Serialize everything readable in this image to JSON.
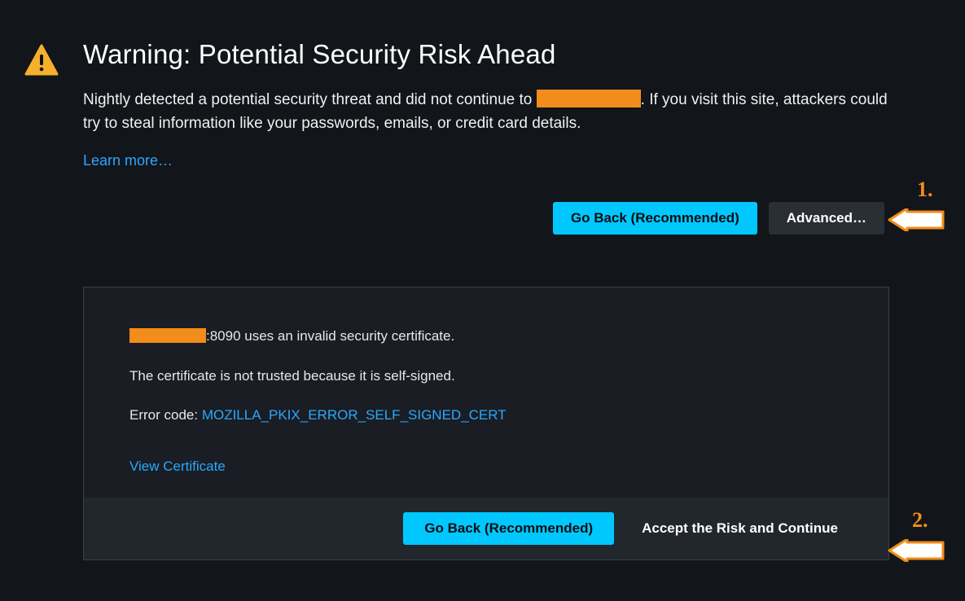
{
  "warning": {
    "title": "Warning: Potential Security Risk Ahead",
    "body_before": "Nightly detected a potential security threat and did not continue to ",
    "body_after": ". If you visit this site, attackers could try to steal information like your passwords, emails, or credit card details.",
    "learn_more": "Learn more…"
  },
  "buttons": {
    "go_back": "Go Back (Recommended)",
    "advanced": "Advanced…",
    "go_back_2": "Go Back (Recommended)",
    "accept_risk": "Accept the Risk and Continue"
  },
  "advanced_panel": {
    "line1_after": ":8090 uses an invalid security certificate.",
    "line2": "The certificate is not trusted because it is self-signed.",
    "error_code_label": "Error code: ",
    "error_code": "MOZILLA_PKIX_ERROR_SELF_SIGNED_CERT",
    "view_certificate": "View Certificate"
  },
  "annotations": {
    "one": "1.",
    "two": "2."
  }
}
